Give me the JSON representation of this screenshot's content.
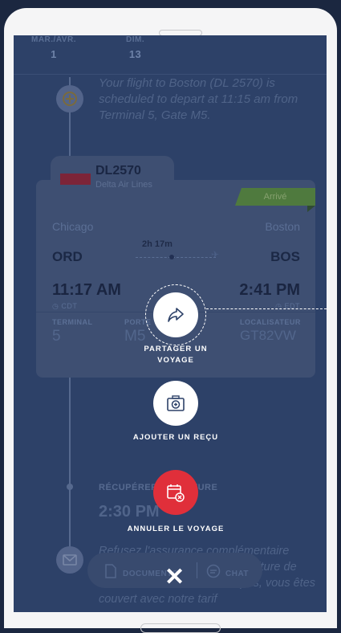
{
  "header": {
    "days": [
      {
        "label": "MAR./AVR.",
        "num": "1"
      },
      {
        "label": "DIM.",
        "num": "13"
      }
    ]
  },
  "event1": {
    "text": "Your flight to Boston (DL 2570) is scheduled to depart at 11:15 am from Terminal 5, Gate M5."
  },
  "flight": {
    "number": "DL2570",
    "airline": "Delta Air Lines",
    "status": "Arrivé",
    "from_city": "Chicago",
    "to_city": "Boston",
    "from_code": "ORD",
    "to_code": "BOS",
    "duration": "2h 17m",
    "dep_time": "11:17 AM",
    "dep_tz": "CDT",
    "arr_time": "2:41 PM",
    "arr_tz": "EDT",
    "terminal_label": "TERMINAL",
    "terminal": "5",
    "gate_label": "PORTE",
    "gate": "M5",
    "locator_label": "LOCALISATEUR",
    "locator": "GT82VW"
  },
  "event2": {
    "label": "RÉCUPÉRER LA VOITURE",
    "time": "2:30 PM"
  },
  "event3": {
    "text": "Refusez l'assurance complémentaire collision et dommages de la voiture de location. Si vous la refusez pas, vous êtes couvert avec notre tarif"
  },
  "actions": {
    "share_label_1": "PARTAGER UN",
    "share_label_2": "VOYAGE",
    "receipt_label": "AJOUTER UN REÇU",
    "cancel_label": "ANNULER LE VOYAGE"
  },
  "bottom_bar": {
    "documents": "DOCUMENTS",
    "chat": "CHAT"
  },
  "colors": {
    "overlay_bg": "#2d4168",
    "cancel_red": "#e02f3a",
    "arrived_green": "#4f7a3e"
  }
}
